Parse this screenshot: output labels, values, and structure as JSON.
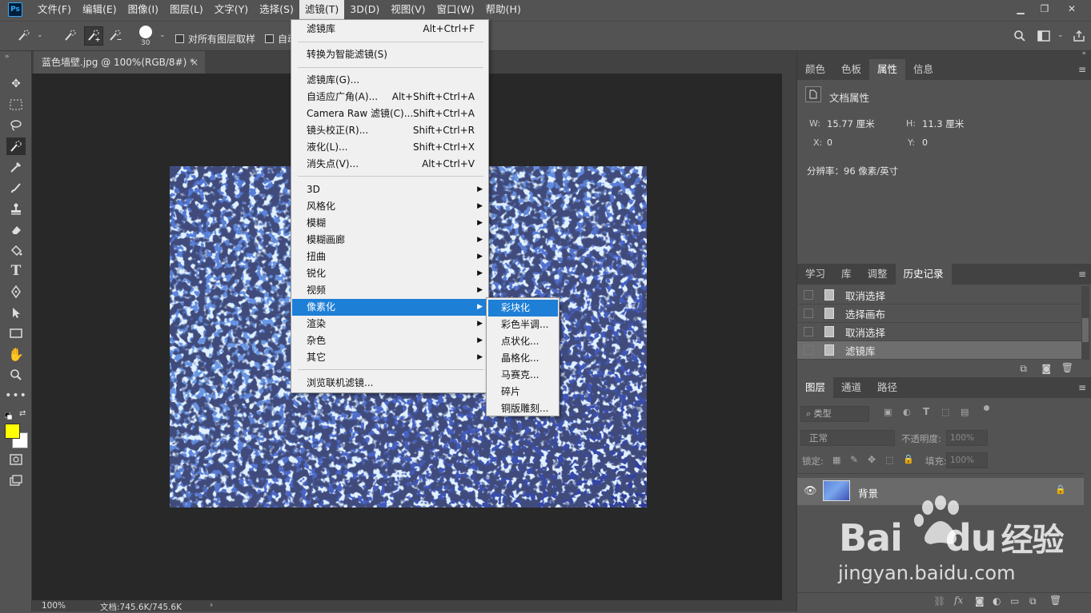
{
  "menubar": {
    "logo": "Ps",
    "items": [
      "文件(F)",
      "编辑(E)",
      "图像(I)",
      "图层(L)",
      "文字(Y)",
      "选择(S)",
      "滤镜(T)",
      "3D(D)",
      "视图(V)",
      "窗口(W)",
      "帮助(H)"
    ],
    "active_index": 6
  },
  "options": {
    "brush_size": "30",
    "sample_all_layers": "对所有图层取样",
    "auto_enhance": "自动"
  },
  "document": {
    "tab_title": "蓝色墙壁.jpg @ 100%(RGB/8#) *",
    "close": "×",
    "zoom": "100%",
    "doc_info": "文档:745.6K/745.6K",
    "status_arrow": "›"
  },
  "filter_menu": {
    "items": [
      {
        "label": "滤镜库",
        "shortcut": "Alt+Ctrl+F"
      },
      {
        "label": "转换为智能滤镜(S)",
        "shortcut": ""
      },
      {
        "label": "滤镜库(G)...",
        "shortcut": ""
      },
      {
        "label": "自适应广角(A)...",
        "shortcut": "Alt+Shift+Ctrl+A"
      },
      {
        "label": "Camera Raw 滤镜(C)...",
        "shortcut": "Shift+Ctrl+A"
      },
      {
        "label": "镜头校正(R)...",
        "shortcut": "Shift+Ctrl+R"
      },
      {
        "label": "液化(L)...",
        "shortcut": "Shift+Ctrl+X"
      },
      {
        "label": "消失点(V)...",
        "shortcut": "Alt+Ctrl+V"
      },
      {
        "label": "3D",
        "submenu": true
      },
      {
        "label": "风格化",
        "submenu": true
      },
      {
        "label": "模糊",
        "submenu": true
      },
      {
        "label": "模糊画廊",
        "submenu": true
      },
      {
        "label": "扭曲",
        "submenu": true
      },
      {
        "label": "锐化",
        "submenu": true
      },
      {
        "label": "视频",
        "submenu": true
      },
      {
        "label": "像素化",
        "submenu": true,
        "highlighted": true
      },
      {
        "label": "渲染",
        "submenu": true
      },
      {
        "label": "杂色",
        "submenu": true
      },
      {
        "label": "其它",
        "submenu": true
      },
      {
        "label": "浏览联机滤镜...",
        "shortcut": ""
      }
    ]
  },
  "pixelate_submenu": {
    "items": [
      "彩块化",
      "彩色半调...",
      "点状化...",
      "晶格化...",
      "马赛克...",
      "碎片",
      "铜版雕刻..."
    ],
    "highlighted_index": 0
  },
  "properties_panel": {
    "tabs": [
      "颜色",
      "色板",
      "属性",
      "信息"
    ],
    "selected_tab": 2,
    "section_title": "文档属性",
    "w_label": "W:",
    "w_value": "15.77 厘米",
    "h_label": "H:",
    "h_value": "11.3 厘米",
    "x_label": "X:",
    "x_value": "0",
    "y_label": "Y:",
    "y_value": "0",
    "resolution": "分辨率：96 像素/英寸"
  },
  "history_panel": {
    "tabs": [
      "学习",
      "库",
      "调整",
      "历史记录"
    ],
    "selected_tab": 3,
    "items": [
      "取消选择",
      "选择画布",
      "取消选择",
      "滤镜库"
    ],
    "selected_item": 3
  },
  "layers_panel": {
    "tabs": [
      "图层",
      "通道",
      "路径"
    ],
    "selected_tab": 0,
    "filter_type": "类型",
    "blend_mode": "正常",
    "opacity_label": "不透明度:",
    "opacity_value": "100%",
    "lock_label": "锁定:",
    "fill_label": "填充:",
    "fill_value": "100%",
    "layer_name": "背景"
  },
  "watermark": {
    "brand": "Bai",
    "brand2": "du",
    "suffix": "经验",
    "url": "jingyan.baidu.com"
  },
  "colors": {
    "foreground": "#ffff00",
    "background": "#ffffff",
    "highlight": "#1e7fd6"
  }
}
